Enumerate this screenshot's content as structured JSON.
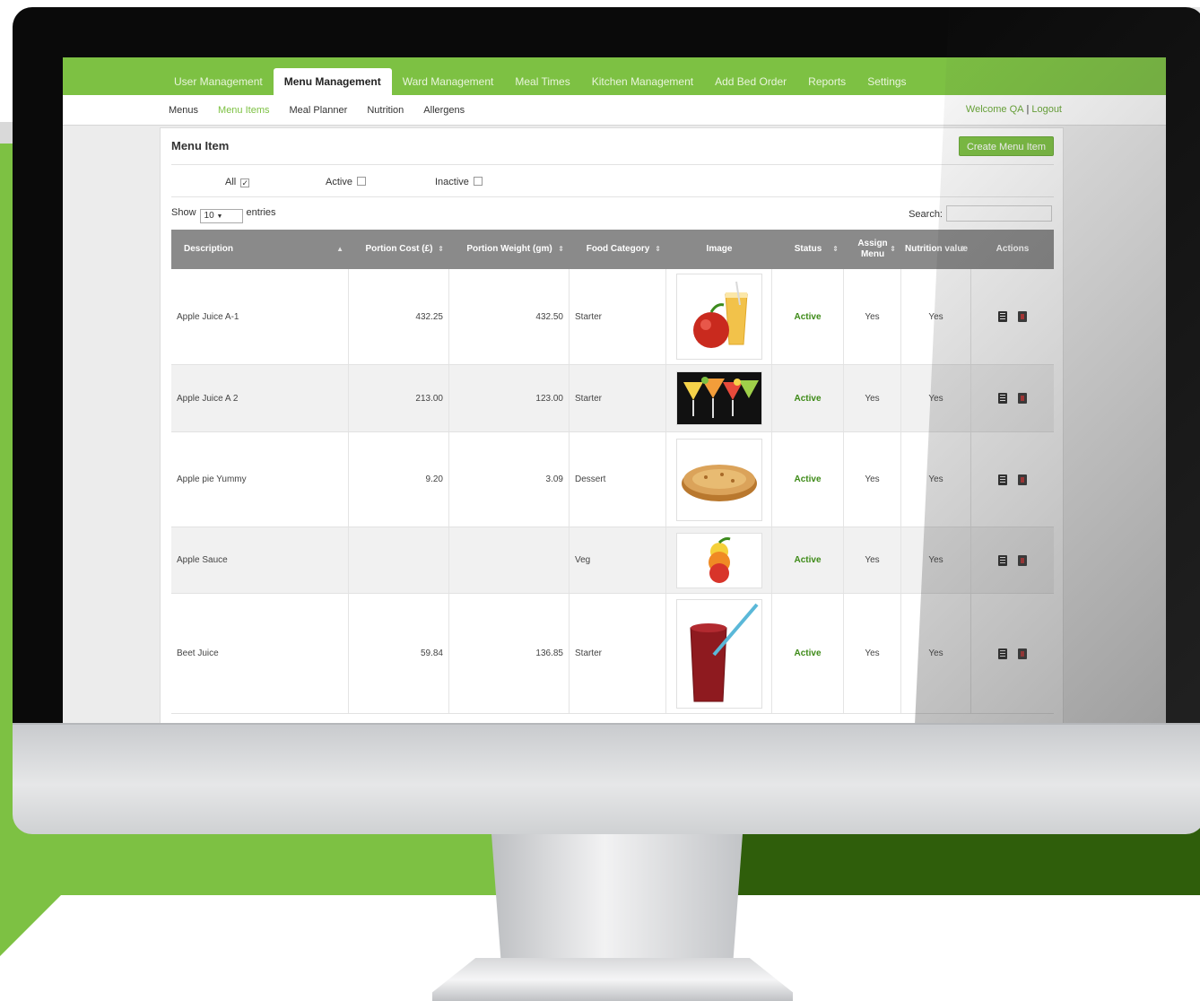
{
  "top_nav": {
    "tabs": [
      {
        "label": "User Management"
      },
      {
        "label": "Menu Management",
        "active": true
      },
      {
        "label": "Ward Management"
      },
      {
        "label": "Meal Times"
      },
      {
        "label": "Kitchen Management"
      },
      {
        "label": "Add Bed Order"
      },
      {
        "label": "Reports"
      },
      {
        "label": "Settings"
      }
    ]
  },
  "sub_nav": {
    "items": [
      {
        "label": "Menus"
      },
      {
        "label": "Menu Items",
        "active": true
      },
      {
        "label": "Meal Planner"
      },
      {
        "label": "Nutrition"
      },
      {
        "label": "Allergens"
      }
    ],
    "welcome": "Welcome QA",
    "separator": "|",
    "logout": "Logout"
  },
  "panel": {
    "title": "Menu Item",
    "create_button": "Create Menu Item",
    "filters": {
      "all": "All",
      "active": "Active",
      "inactive": "Inactive",
      "all_checked": true,
      "active_checked": false,
      "inactive_checked": false
    },
    "show_label": "Show",
    "show_value": "10",
    "entries_label": "entries",
    "search_label": "Search:",
    "search_value": ""
  },
  "table": {
    "headers": {
      "description": "Description",
      "portion_cost": "Portion Cost (£)",
      "portion_weight": "Portion Weight (gm)",
      "food_category": "Food Category",
      "image": "Image",
      "status": "Status",
      "assign_menu": "Assign Menu",
      "nutrition_value": "Nutrition value",
      "actions": "Actions"
    },
    "rows": [
      {
        "description": "Apple Juice A-1",
        "cost": "432.25",
        "weight": "432.50",
        "category": "Starter",
        "image": "apple-juice",
        "status": "Active",
        "assign": "Yes",
        "nutrition": "Yes"
      },
      {
        "description": "Apple Juice A 2",
        "cost": "213.00",
        "weight": "123.00",
        "category": "Starter",
        "image": "cocktails",
        "status": "Active",
        "assign": "Yes",
        "nutrition": "Yes"
      },
      {
        "description": "Apple pie Yummy",
        "cost": "9.20",
        "weight": "3.09",
        "category": "Dessert",
        "image": "apple-pie",
        "status": "Active",
        "assign": "Yes",
        "nutrition": "Yes"
      },
      {
        "description": "Apple Sauce",
        "cost": "",
        "weight": "",
        "category": "Veg",
        "image": "fruit-stack",
        "status": "Active",
        "assign": "Yes",
        "nutrition": "Yes"
      },
      {
        "description": "Beet Juice",
        "cost": "59.84",
        "weight": "136.85",
        "category": "Starter",
        "image": "beet-juice",
        "status": "Active",
        "assign": "Yes",
        "nutrition": "Yes"
      }
    ]
  },
  "colors": {
    "brand_green": "#7dc143",
    "dark_green": "#2f5e0b",
    "table_header": "#8a8a8a",
    "status_green": "#3d8a17"
  }
}
